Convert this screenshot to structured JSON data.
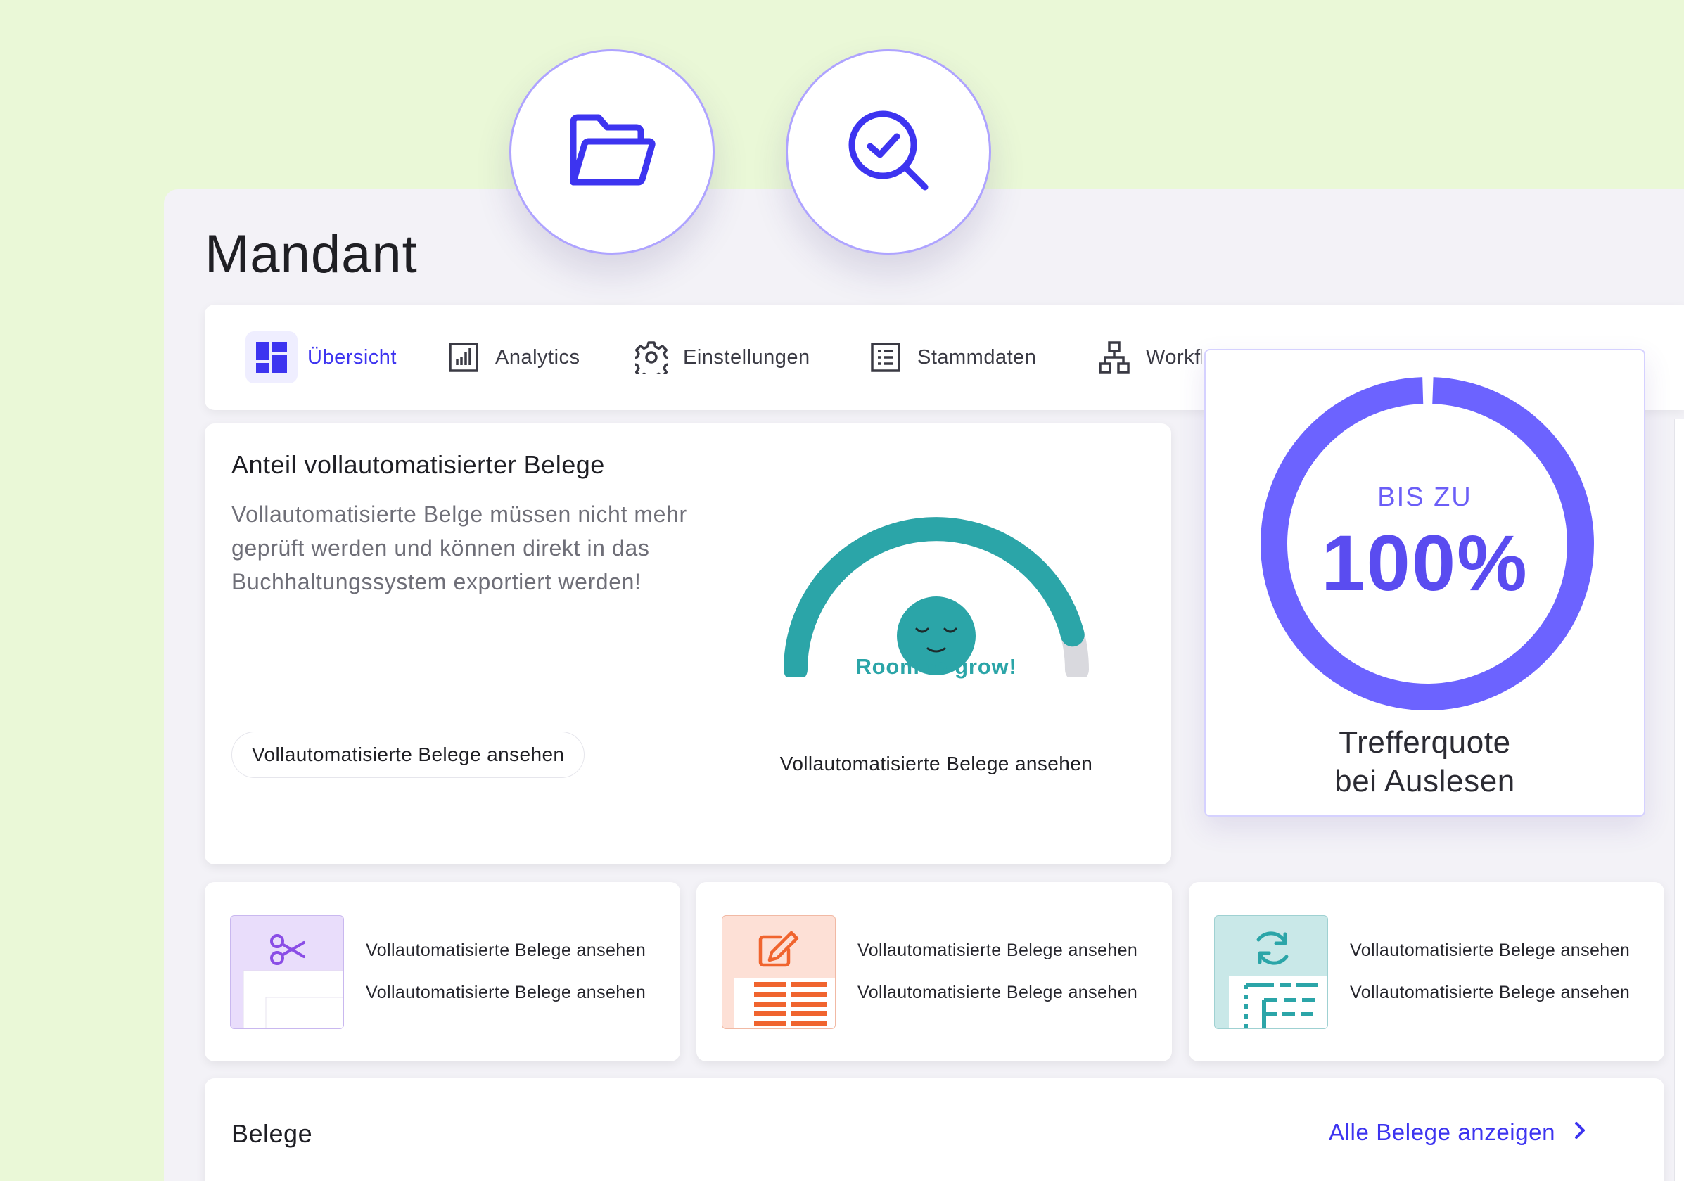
{
  "page": {
    "title": "Mandant"
  },
  "tabs": [
    {
      "label": "Übersicht",
      "icon": "dashboard-icon",
      "active": true
    },
    {
      "label": "Analytics",
      "icon": "bar-chart-icon"
    },
    {
      "label": "Einstellungen",
      "icon": "gear-icon"
    },
    {
      "label": "Stammdaten",
      "icon": "list-icon"
    },
    {
      "label": "Workfl",
      "icon": "hierarchy-icon"
    }
  ],
  "floating_icons": [
    "folder-open-icon",
    "search-check-icon"
  ],
  "main_card": {
    "title": "Anteil vollautomatisierter Belege",
    "description": "Vollautomatisierte Belge müssen nicht mehr geprüft werden und können direkt in das Buchhaltungssystem exportiert werden!",
    "button": "Vollautomatisierte Belege ansehen",
    "gauge_caption": "Room to grow!",
    "gauge_link": "Vollautomatisierte Belege ansehen",
    "gauge_level": 0.92
  },
  "stat_card": {
    "prefix": "BIS ZU",
    "value": "100%",
    "label_line1": "Trefferquote",
    "label_line2": "bei Auslesen"
  },
  "small_cards": [
    {
      "icon": "scissors-icon",
      "line1": "Vollautomatisierte Belege ansehen",
      "line2": "Vollautomatisierte Belege ansehen"
    },
    {
      "icon": "edit-icon",
      "line1": "Vollautomatisierte Belege ansehen",
      "line2": "Vollautomatisierte Belege ansehen"
    },
    {
      "icon": "refresh-icon",
      "line1": "Vollautomatisierte Belege ansehen",
      "line2": "Vollautomatisierte Belege ansehen"
    }
  ],
  "belege": {
    "title": "Belege",
    "link": "Alle Belege anzeigen"
  },
  "colors": {
    "accent": "#3d34f0",
    "stat_ring": "#6c63ff",
    "gauge": "#2ba5a8",
    "background": "#eaf8d7"
  }
}
